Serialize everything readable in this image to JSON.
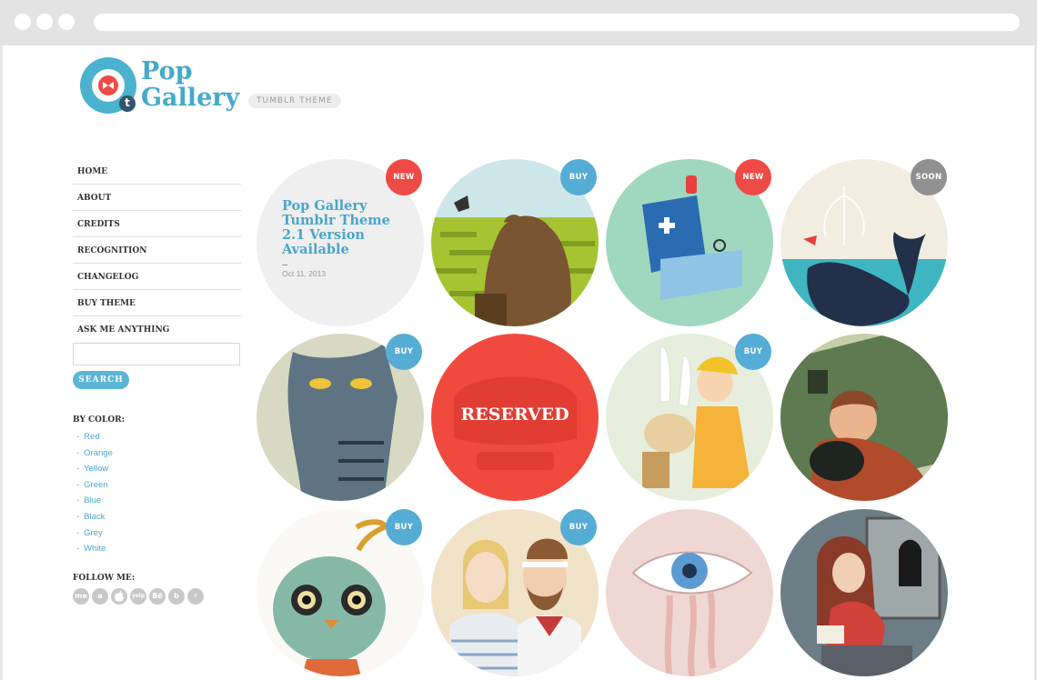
{
  "logo": {
    "line1": "Pop",
    "line2": "Gallery",
    "badge": "TUMBLR THEME",
    "tumblr_letter": "t"
  },
  "nav": [
    "HOME",
    "ABOUT",
    "CREDITS",
    "RECOGNITION",
    "CHANGELOG",
    "BUY THEME",
    "ASK ME ANYTHING"
  ],
  "search": {
    "button": "SEARCH",
    "value": ""
  },
  "by_color": {
    "heading": "BY COLOR:",
    "items": [
      "Red",
      "Orange",
      "Yellow",
      "Green",
      "Blue",
      "Black",
      "Grey",
      "White"
    ]
  },
  "follow": {
    "heading": "FOLLOW ME:",
    "icons": [
      "me",
      "a",
      "",
      "yelp",
      "Bē",
      "b",
      "⚡"
    ]
  },
  "post": {
    "title": "Pop Gallery Tumblr Theme 2.1 Version Available",
    "date": "Oct 11, 2013",
    "badge": "NEW"
  },
  "tiles": [
    {
      "badge": "BUY",
      "subject": "bear in green field"
    },
    {
      "badge": "NEW",
      "subject": "blue robot"
    },
    {
      "badge": "SOON",
      "subject": "whale with fountain"
    },
    {
      "badge": "BUY",
      "subject": "grey striped cat"
    },
    {
      "badge": "",
      "subject": "reserved",
      "overlay": "RESERVED"
    },
    {
      "badge": "BUY",
      "subject": "girl with bunny and dog"
    },
    {
      "badge": "",
      "subject": "boy hugging cat by house"
    },
    {
      "badge": "BUY",
      "subject": "green owl creature"
    },
    {
      "badge": "BUY",
      "subject": "couple portrait"
    },
    {
      "badge": "",
      "subject": "crying blue eye"
    },
    {
      "badge": "",
      "subject": "girl reading with cat"
    }
  ],
  "colors": {
    "accent": "#4bb3d0",
    "red": "#ef4a45",
    "soon": "#909090"
  }
}
